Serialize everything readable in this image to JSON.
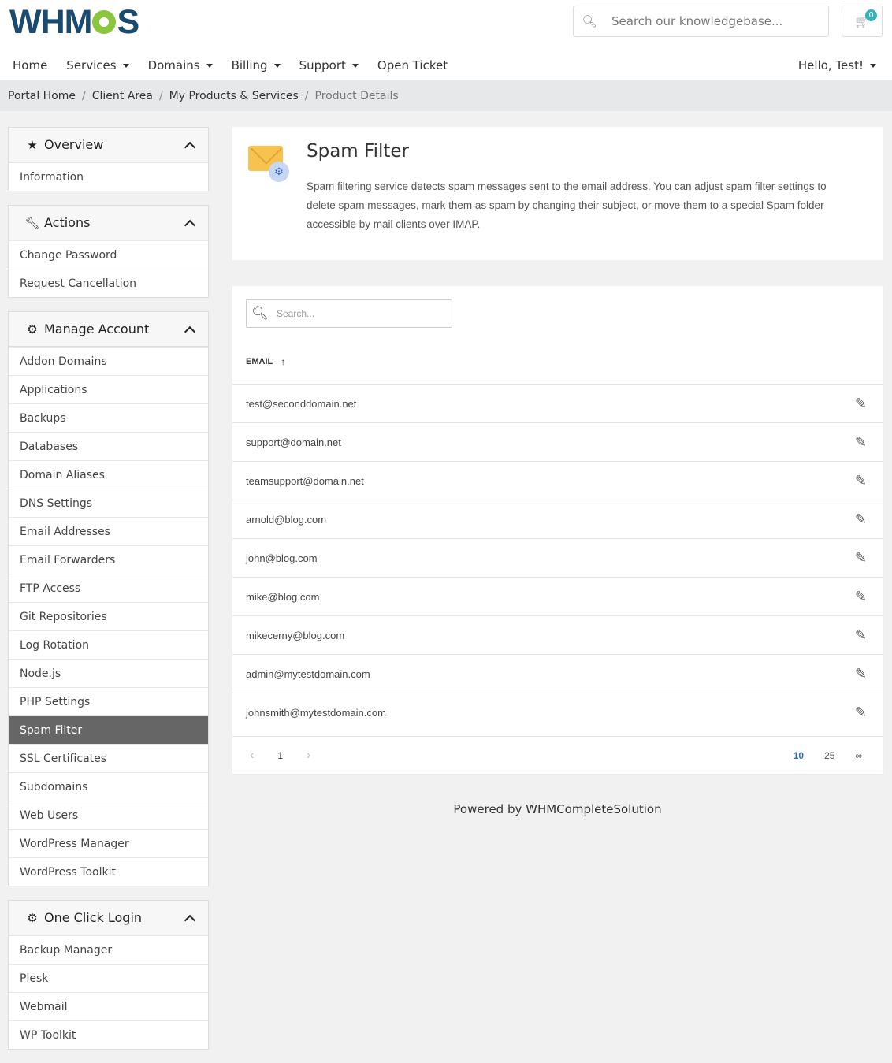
{
  "brand": {
    "logo_text_a": "WHM",
    "logo_text_b": "S"
  },
  "header": {
    "search_placeholder": "Search our knowledgebase...",
    "cart_count": "0",
    "nav": [
      {
        "label": "Home"
      },
      {
        "label": "Services"
      },
      {
        "label": "Domains"
      },
      {
        "label": "Billing"
      },
      {
        "label": "Support"
      },
      {
        "label": "Open Ticket"
      }
    ],
    "user_menu": "Hello, Test!"
  },
  "breadcrumb": [
    "Portal Home",
    "Client Area",
    "My Products & Services",
    "Product Details"
  ],
  "sidebar": {
    "overview": {
      "title": "Overview",
      "items": [
        "Information"
      ]
    },
    "actions": {
      "title": "Actions",
      "items": [
        "Change Password",
        "Request Cancellation"
      ]
    },
    "manage": {
      "title": "Manage Account",
      "items": [
        "Addon Domains",
        "Applications",
        "Backups",
        "Databases",
        "Domain Aliases",
        "DNS Settings",
        "Email Addresses",
        "Email Forwarders",
        "FTP Access",
        "Git Repositories",
        "Log Rotation",
        "Node.js",
        "PHP Settings",
        "Spam Filter",
        "SSL Certificates",
        "Subdomains",
        "Web Users",
        "WordPress Manager",
        "WordPress Toolkit"
      ],
      "active": "Spam Filter"
    },
    "oneclick": {
      "title": "One Click Login",
      "items": [
        "Backup Manager",
        "Plesk",
        "Webmail",
        "WP Toolkit"
      ]
    }
  },
  "intro": {
    "title": "Spam Filter",
    "description": "Spam filtering service detects spam messages sent to the email address. You can adjust spam filter settings to delete spam messages, mark them as spam by changing their subject, or move them to a special Spam folder accessible by mail clients over IMAP."
  },
  "table": {
    "search_placeholder": "Search...",
    "column_header": "EMAIL",
    "rows": [
      "test@seconddomain.net",
      "support@domain.net",
      "teamsupport@domain.net",
      "arnold@blog.com",
      "john@blog.com",
      "mike@blog.com",
      "mikecerny@blog.com",
      "admin@mytestdomain.com",
      "johnsmith@mytestdomain.com"
    ],
    "pagination": {
      "current_page": "1",
      "page_sizes": [
        "10",
        "25",
        "∞"
      ],
      "active_size": "10"
    }
  },
  "footer": {
    "text": "Powered by WHMCompleteSolution"
  }
}
